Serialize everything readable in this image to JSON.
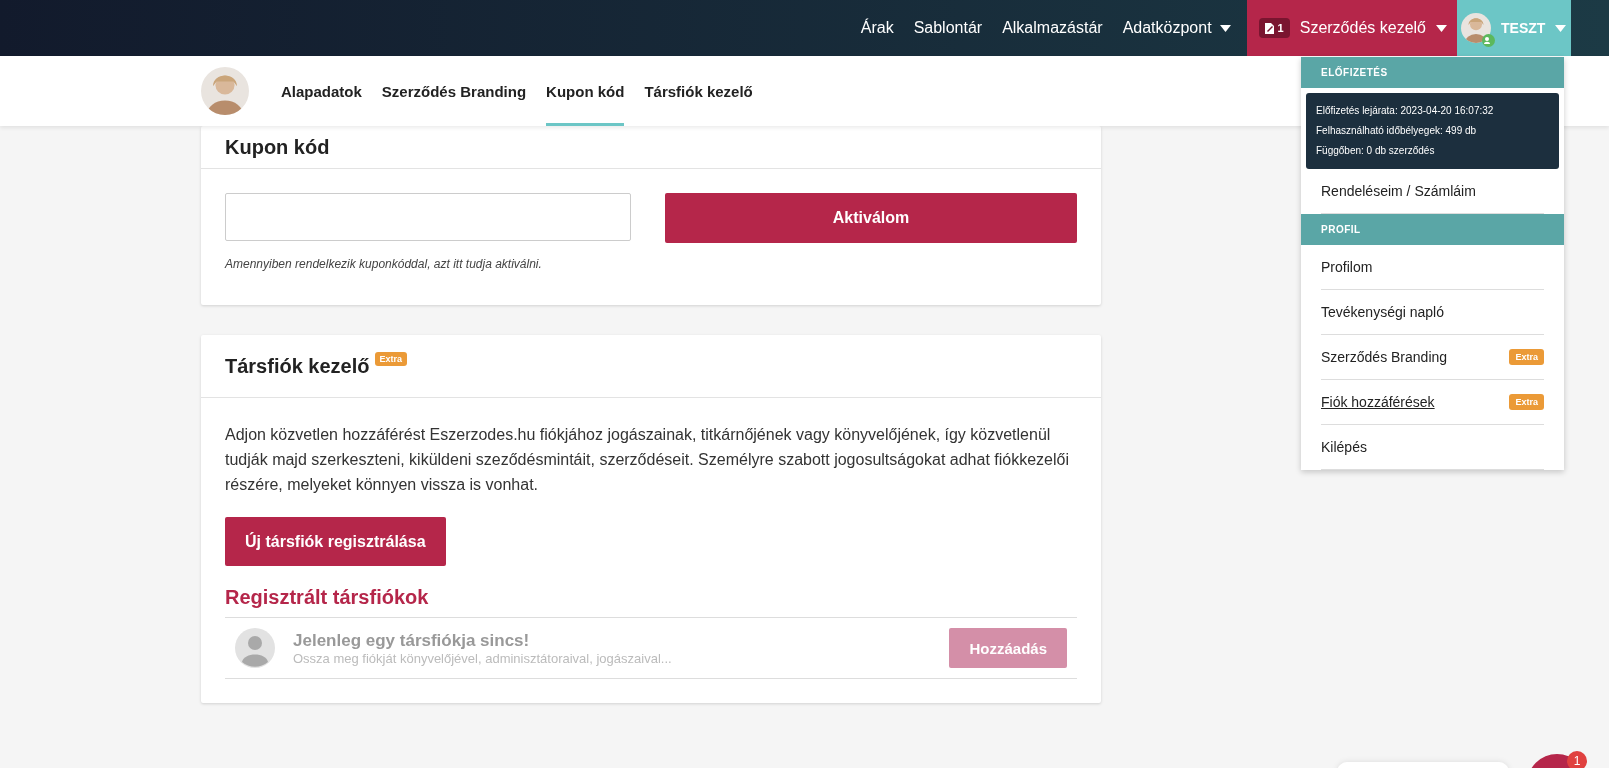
{
  "top_nav": {
    "links": [
      {
        "label": "Árak",
        "kind": "link"
      },
      {
        "label": "Sablontár",
        "kind": "link"
      },
      {
        "label": "Alkalmazástár",
        "kind": "link"
      },
      {
        "label": "Adatközpont",
        "kind": "dropdown"
      }
    ],
    "contracts_menu": {
      "badge": "1",
      "label": "Szerződés kezelő"
    },
    "user_menu": {
      "label": "TESZT"
    }
  },
  "sub_nav": {
    "tabs": [
      {
        "label": "Alapadatok",
        "selected": false
      },
      {
        "label": "Szerződés Branding",
        "selected": false
      },
      {
        "label": "Kupon kód",
        "selected": true
      },
      {
        "label": "Társfiók kezelő",
        "selected": false
      }
    ]
  },
  "coupon_card": {
    "title": "Kupon kód",
    "button": "Aktiválom",
    "hint": "Amennyiben rendelkezik kuponkóddal, azt itt tudja aktiválni."
  },
  "subaccount_card": {
    "title": "Társfiók kezelő",
    "badge": "Extra",
    "description": "Adjon közvetlen hozzáférést Eszerzodes.hu fiókjához jogászainak, titkárnőjének vagy könyvelőjének, így közvetlenül tudják majd szerkeszteni, kiküldeni szeződésmintáit, szerződéseit. Személyre szabott jogosultságokat adhat fiókkezelői részére, melyeket könnyen vissza is vonhat.",
    "register_button": "Új társfiók regisztrálása",
    "list_title": "Regisztrált társfiókok",
    "empty_row": {
      "title": "Jelenleg egy társfiókja sincs!",
      "subtitle": "Ossza meg fiókját könyvelőjével, adminisztátoraival, jogászaival...",
      "button": "Hozzáadás",
      "disabled": true
    }
  },
  "dropdown": {
    "sections": [
      {
        "heading": "ELŐFIZETÉS",
        "info_lines": [
          "Előfizetés lejárata: 2023-04-20 16:07:32",
          "Felhasználható időbélyegek: 499 db",
          "Függőben: 0 db szerződés"
        ],
        "items": [
          {
            "label": "Rendeléseim / Számláim",
            "hovered": false
          }
        ]
      },
      {
        "heading": "PROFIL",
        "items": [
          {
            "label": "Profilom",
            "hovered": false
          },
          {
            "label": "Tevékenységi napló",
            "hovered": false
          },
          {
            "label": "Szerződés Branding",
            "badge": "Extra",
            "hovered": false
          },
          {
            "label": "Fiók hozzáférések",
            "badge": "Extra",
            "hovered": true
          },
          {
            "label": "Kilépés",
            "hovered": false
          }
        ]
      }
    ]
  },
  "chat": {
    "badge": "1"
  }
}
